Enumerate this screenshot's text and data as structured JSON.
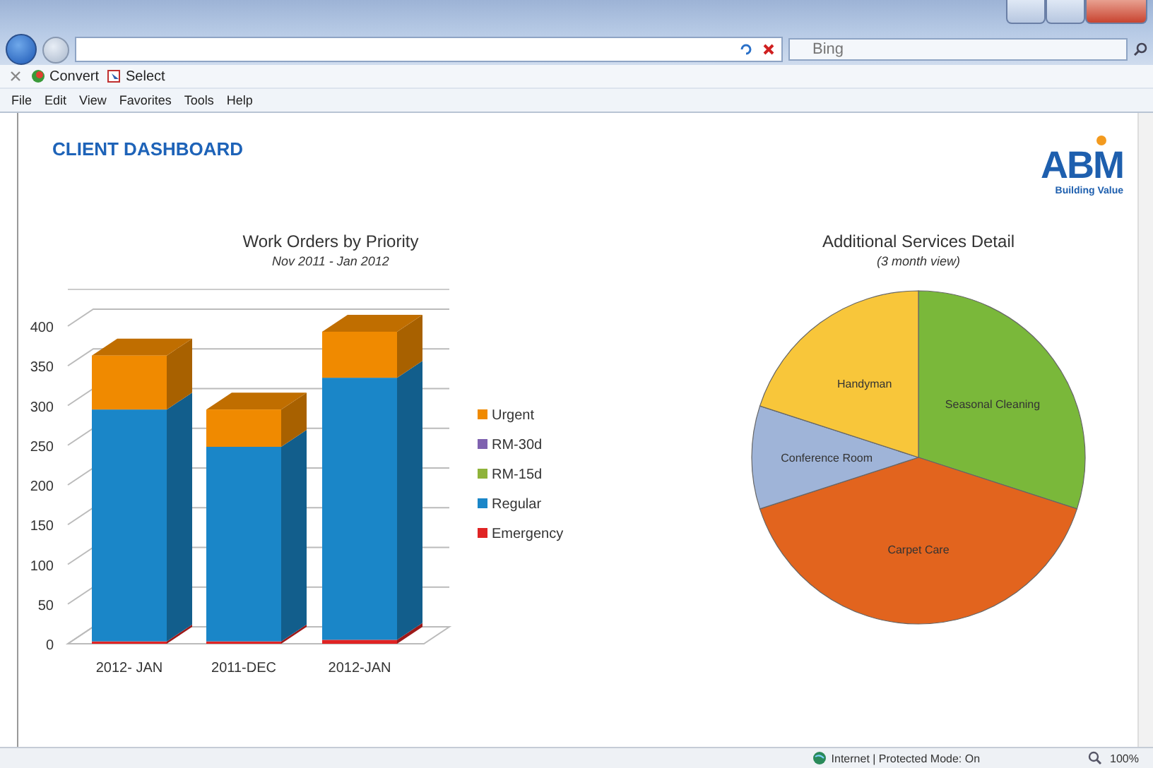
{
  "browser": {
    "search": {
      "placeholder": "Bing"
    },
    "toolbar": [
      {
        "label": "Convert",
        "kind": "convert"
      },
      {
        "label": "Select",
        "kind": "select"
      }
    ],
    "menu": [
      "File",
      "Edit",
      "View",
      "Favorites",
      "Tools",
      "Help"
    ]
  },
  "page": {
    "title": "CLIENT DASHBOARD",
    "logo": {
      "name": "ABM",
      "tagline": "Building Value"
    },
    "bar_chart": {
      "chart_data": {
        "type": "bar",
        "title": "Work Orders by Priority",
        "subtitle": "Nov 2011 - Jan 2012",
        "stacked": true,
        "legend": true,
        "categories": [
          "2012- JAN",
          "2011-DEC",
          "2012-JAN"
        ],
        "yticks": [
          0,
          50,
          100,
          150,
          200,
          250,
          300,
          350,
          400
        ],
        "ylim": [
          0,
          400
        ],
        "series": [
          {
            "name": "Emergency",
            "color": "#e02424",
            "values": [
              3,
              3,
              5
            ]
          },
          {
            "name": "Regular",
            "color": "#1a86c8",
            "values": [
              292,
              245,
              330
            ]
          },
          {
            "name": "RM-15d",
            "color": "#8fb33a",
            "values": [
              0,
              0,
              0
            ]
          },
          {
            "name": "RM-30d",
            "color": "#7f62b0",
            "values": [
              0,
              0,
              0
            ]
          },
          {
            "name": "Urgent",
            "color": "#f08a00",
            "values": [
              68,
              47,
              58
            ]
          }
        ]
      }
    },
    "pie_chart": {
      "chart_data": {
        "type": "pie",
        "title": "Additional Services Detail",
        "subtitle": "(3 month view)",
        "categories": [
          "Seasonal Cleaning",
          "Carpet Care",
          "Conference Room",
          "Handyman"
        ],
        "colors": [
          "#7ab83a",
          "#e2641e",
          "#9fb4d8",
          "#f8c63a"
        ],
        "values": [
          30,
          40,
          10,
          20
        ]
      }
    }
  },
  "status_bar": {
    "zone": "Internet | Protected Mode: On",
    "zoom": "100%"
  }
}
